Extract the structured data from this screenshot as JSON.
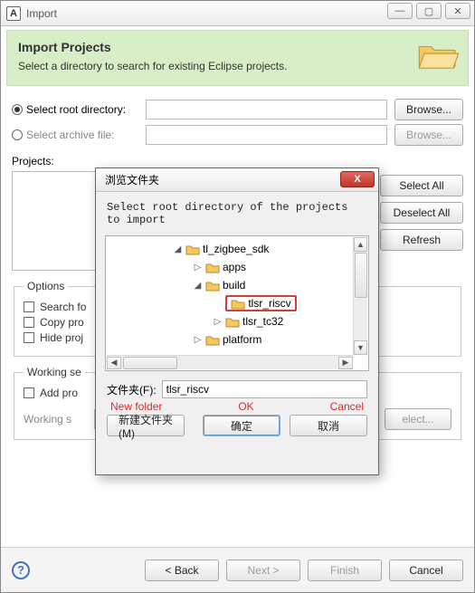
{
  "window": {
    "title": "Import"
  },
  "banner": {
    "heading": "Import Projects",
    "sub": "Select a directory to search for existing Eclipse projects."
  },
  "roots": {
    "root_label": "Select root directory:",
    "archive_label": "Select archive file:",
    "browse": "Browse...",
    "browse_disabled": "Browse..."
  },
  "projects": {
    "label": "Projects:",
    "select_all": "Select All",
    "deselect_all": "Deselect All",
    "refresh": "Refresh"
  },
  "options": {
    "legend": "Options",
    "search": "Search fo",
    "copy": "Copy pro",
    "hide": "Hide proj"
  },
  "workingsets": {
    "legend": "Working se",
    "add": "Add pro",
    "combo_placeholder": "Working sets",
    "select_btn": "elect..."
  },
  "footer": {
    "back": "< Back",
    "next": "Next >",
    "finish": "Finish",
    "cancel": "Cancel"
  },
  "sub": {
    "title": "浏览文件夹",
    "instr": "Select root directory of the projects to import",
    "tree": {
      "n0": "tl_zigbee_sdk",
      "n1": "apps",
      "n2": "build",
      "n3": "tlsr_riscv",
      "n4": "tlsr_tc32",
      "n5": "platform"
    },
    "folder_label": "文件夹(F):",
    "folder_value": "tlsr_riscv",
    "red": {
      "newf": "New folder",
      "ok": "OK",
      "cancel": "Cancel"
    },
    "btns": {
      "newf": "新建文件夹(M)",
      "ok": "确定",
      "cancel": "取消"
    }
  }
}
